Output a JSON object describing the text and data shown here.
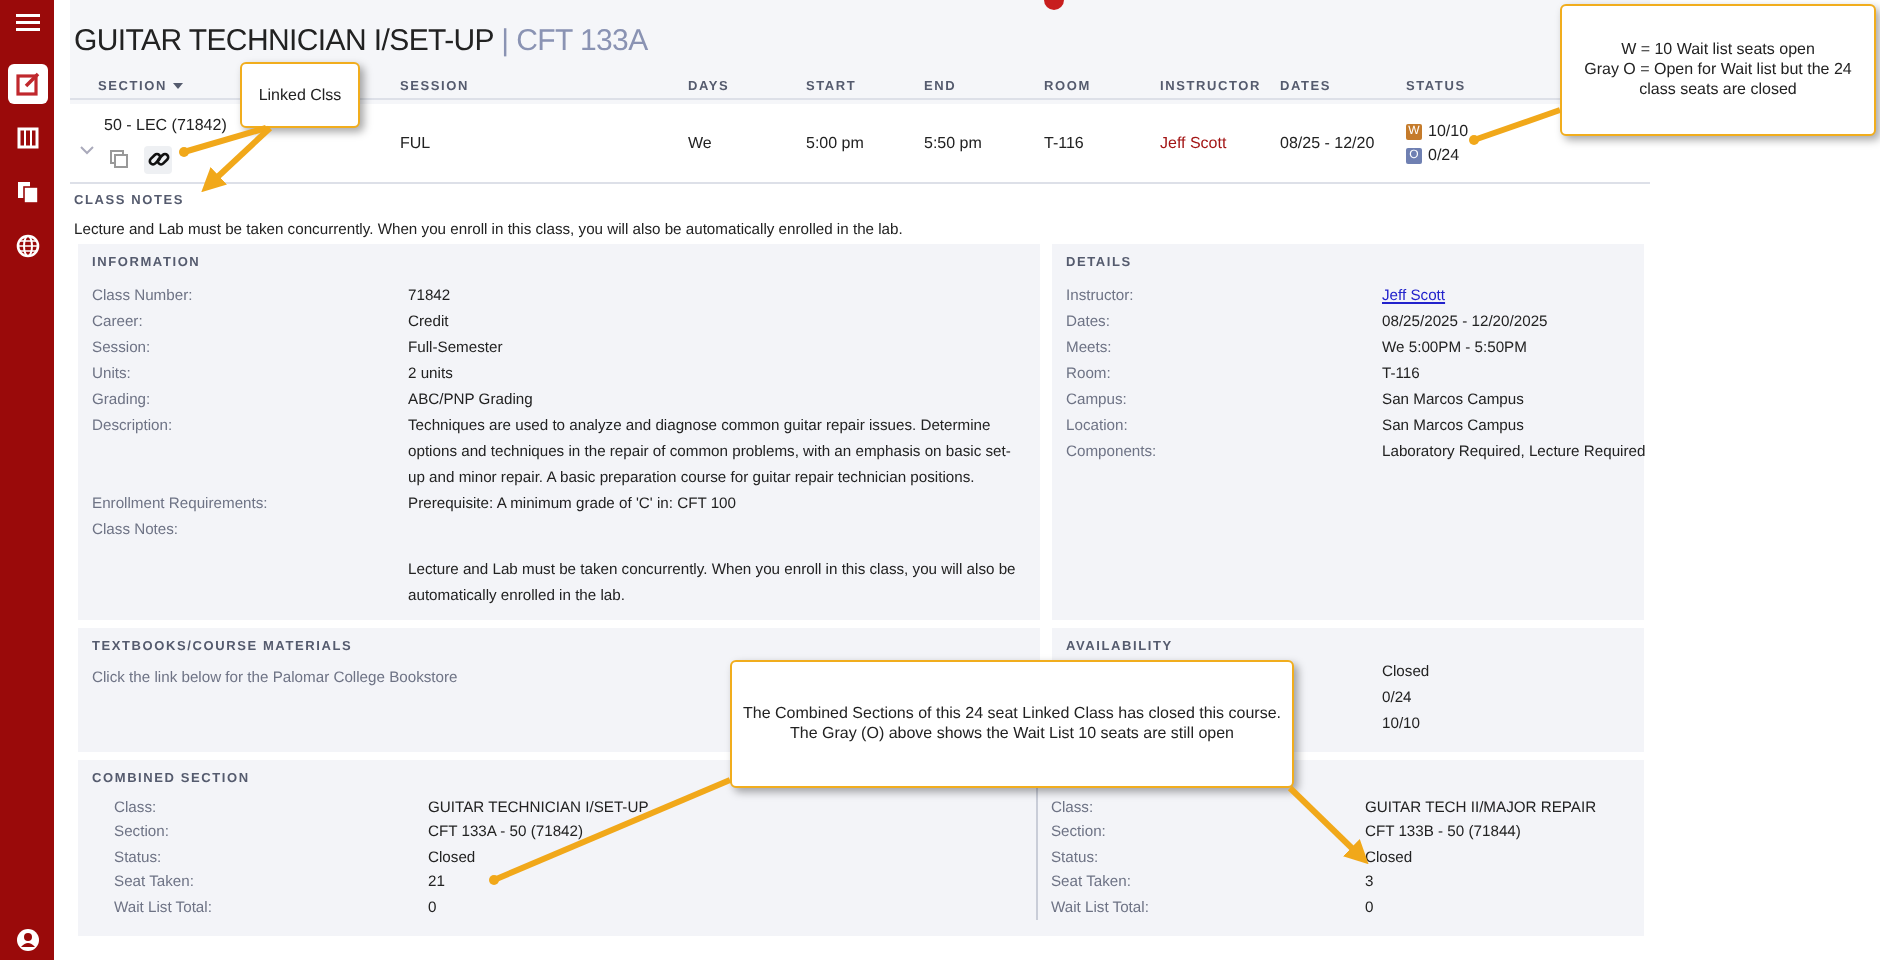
{
  "title": "GUITAR TECHNICIAN I/SET-UP",
  "separator": "|",
  "course_code": "CFT 133A",
  "sidebar": {
    "items": [
      {
        "selected": true
      },
      {
        "selected": false
      },
      {
        "selected": false
      },
      {
        "selected": false
      }
    ]
  },
  "table": {
    "columns": [
      {
        "label": "SECTION",
        "sorted": true
      },
      {
        "label": "SESSION",
        "sorted": false
      },
      {
        "label": "DAYS",
        "sorted": false
      },
      {
        "label": "START",
        "sorted": false
      },
      {
        "label": "END",
        "sorted": false
      },
      {
        "label": "ROOM",
        "sorted": false
      },
      {
        "label": "INSTRUCTOR",
        "sorted": false
      },
      {
        "label": "DATES",
        "sorted": false
      },
      {
        "label": "STATUS",
        "sorted": false
      }
    ],
    "row": {
      "section": "50 - LEC (71842)",
      "session": "FUL",
      "days": "We",
      "start": "5:00 pm",
      "end": "5:50 pm",
      "room": "T-116",
      "instructor": "Jeff Scott",
      "dates": "08/25 - 12/20",
      "status": [
        {
          "letter": "W",
          "text": "10/10",
          "color": "#c57b2b"
        },
        {
          "letter": "O",
          "text": "0/24",
          "color": "#6f80b2"
        }
      ]
    }
  },
  "class_notes": {
    "heading": "CLASS NOTES",
    "text": "Lecture and Lab must be taken concurrently. When you enroll in this class, you will also be automatically enrolled in the lab."
  },
  "information": {
    "heading": "INFORMATION",
    "rows": [
      {
        "label": "Class Number:",
        "value": "71842"
      },
      {
        "label": "Career:",
        "value": "Credit"
      },
      {
        "label": "Session:",
        "value": "Full-Semester"
      },
      {
        "label": "Units:",
        "value": "2 units"
      },
      {
        "label": "Grading:",
        "value": "ABC/PNP Grading"
      },
      {
        "label": "Description:",
        "value": "Techniques are used to analyze and diagnose common guitar repair issues. Determine options and techniques in the repair of common problems, with an emphasis on basic set-up and minor repair. A basic preparation course for guitar repair technician positions."
      },
      {
        "label": "Enrollment Requirements:",
        "value": "Prerequisite: A minimum grade of 'C' in: CFT 100"
      },
      {
        "label": "Class Notes:",
        "value": "Lecture and Lab must be taken concurrently. When you enroll in this class, you will also be automatically enrolled in the lab."
      }
    ]
  },
  "details": {
    "heading": "DETAILS",
    "rows": [
      {
        "label": "Instructor:",
        "value": "Jeff Scott",
        "kind": "link"
      },
      {
        "label": "Dates:",
        "value": "08/25/2025 - 12/20/2025",
        "kind": "text"
      },
      {
        "label": "Meets:",
        "value": "We 5:00PM - 5:50PM",
        "kind": "text"
      },
      {
        "label": "Room:",
        "value": "T-116",
        "kind": "text"
      },
      {
        "label": "Campus:",
        "value": "San Marcos Campus",
        "kind": "text"
      },
      {
        "label": "Location:",
        "value": "San Marcos Campus",
        "kind": "text"
      },
      {
        "label": "Components:",
        "value": "Laboratory Required, Lecture Required",
        "kind": "text"
      }
    ]
  },
  "textbooks": {
    "heading": "TEXTBOOKS/COURSE MATERIALS",
    "text": "Click the link below for the Palomar College Bookstore"
  },
  "availability": {
    "heading": "AVAILABILITY",
    "values": [
      "Closed",
      "0/24",
      "10/10"
    ]
  },
  "combined_section": {
    "heading": "COMBINED SECTION",
    "sections": [
      {
        "rows": [
          {
            "label": "Class:",
            "value": "GUITAR TECHNICIAN I/SET-UP"
          },
          {
            "label": "Section:",
            "value": "CFT 133A - 50 (71842)"
          },
          {
            "label": "Status:",
            "value": "Closed"
          },
          {
            "label": "Seat Taken:",
            "value": "21"
          },
          {
            "label": "Wait List Total:",
            "value": "0"
          }
        ]
      },
      {
        "rows": [
          {
            "label": "Class:",
            "value": "GUITAR TECH II/MAJOR REPAIR"
          },
          {
            "label": "Section:",
            "value": "CFT 133B - 50 (71844)"
          },
          {
            "label": "Status:",
            "value": "Closed"
          },
          {
            "label": "Seat Taken:",
            "value": "3"
          },
          {
            "label": "Wait List Total:",
            "value": "0"
          }
        ]
      }
    ]
  },
  "callouts": [
    {
      "lines": [
        "Linked Clss"
      ]
    },
    {
      "lines": [
        "W = 10 Wait list seats open",
        "Gray O = Open for Wait list but the 24 class seats are closed"
      ]
    },
    {
      "lines": [
        "The Combined Sections of this 24 seat Linked Class has closed this course. The Gray (O) above shows the Wait List 10 seats are still open"
      ]
    }
  ]
}
